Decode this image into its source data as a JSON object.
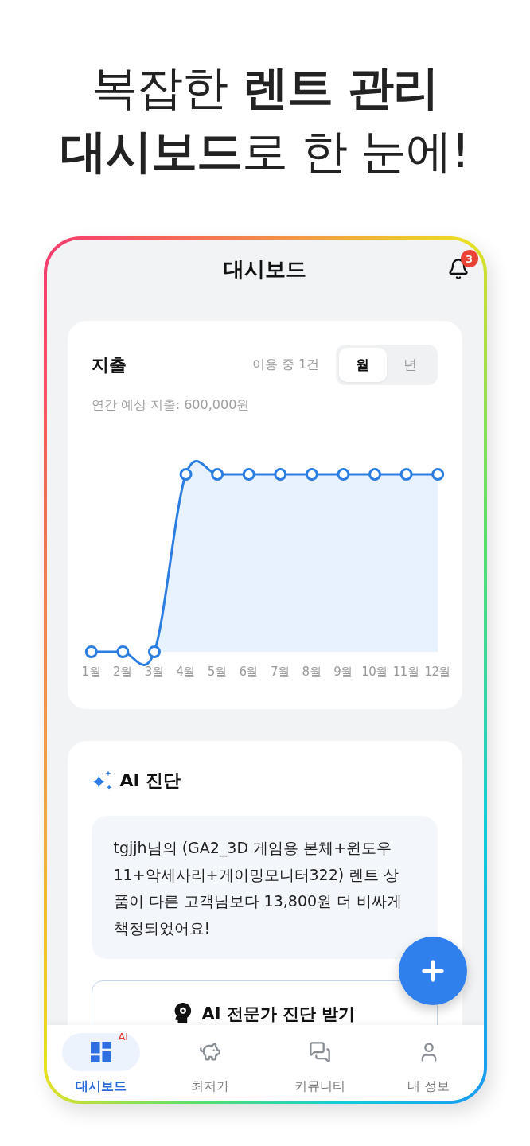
{
  "headline": {
    "lines": [
      "복잡한 **렌트 관리**",
      "**대시보드**로 한 눈에!"
    ]
  },
  "app_bar": {
    "title": "대시보드",
    "notification_badge": "3"
  },
  "expense_card": {
    "title": "지출",
    "active_count": "이용 중 1건",
    "period_toggle": [
      {
        "label": "월",
        "selected": true
      },
      {
        "label": "년",
        "selected": false
      }
    ],
    "annual_estimate": "연간 예상 지출: 600,000원",
    "chart": {
      "x_labels": [
        "1월",
        "2월",
        "3월",
        "4월",
        "5월",
        "6월",
        "7월",
        "8월",
        "9월",
        "10월",
        "11월",
        "12월"
      ]
    }
  },
  "ai_card": {
    "title": "AI 진단",
    "message": "tgjjh님의 (GA2_3D 게임용 본체+윈도우 11+악세사리+게이밍모니터322) 렌트 상품이 다른 고객님보다 13,800원 더 비싸게 책정되었어요!",
    "button": "AI 전문가 진단 받기"
  },
  "bottom_nav": [
    {
      "label": "대시보드",
      "selected": true,
      "badge": "AI"
    },
    {
      "label": "최저가",
      "selected": false
    },
    {
      "label": "커뮤니티",
      "selected": false
    },
    {
      "label": "내 정보",
      "selected": false
    }
  ]
}
